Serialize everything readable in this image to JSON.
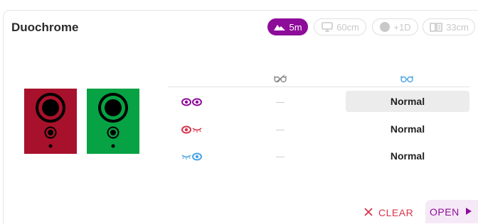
{
  "title": "Duochrome",
  "chips": [
    {
      "label": "5m",
      "icon": "mountain-icon",
      "active": true
    },
    {
      "label": "60cm",
      "icon": "monitor-icon",
      "active": false
    },
    {
      "label": "+1D",
      "icon": "circle-icon",
      "active": false
    },
    {
      "label": "33cm",
      "icon": "book-icon",
      "active": false
    }
  ],
  "colors": {
    "accent": "#8e0c9a",
    "red_panel": "#a8112b",
    "green_panel": "#07a243",
    "clear": "#d8344a"
  },
  "table": {
    "headers": [
      {
        "icon": "glasses-off-icon"
      },
      {
        "icon": "glasses-on-icon"
      }
    ],
    "rows": [
      {
        "eye": "both-eyes-icon",
        "without": "—",
        "with": "Normal"
      },
      {
        "eye": "right-eye-icon",
        "without": "—",
        "with": "Normal"
      },
      {
        "eye": "left-eye-icon",
        "without": "—",
        "with": "Normal"
      }
    ]
  },
  "actions": {
    "clear": "CLEAR",
    "open": "OPEN"
  }
}
